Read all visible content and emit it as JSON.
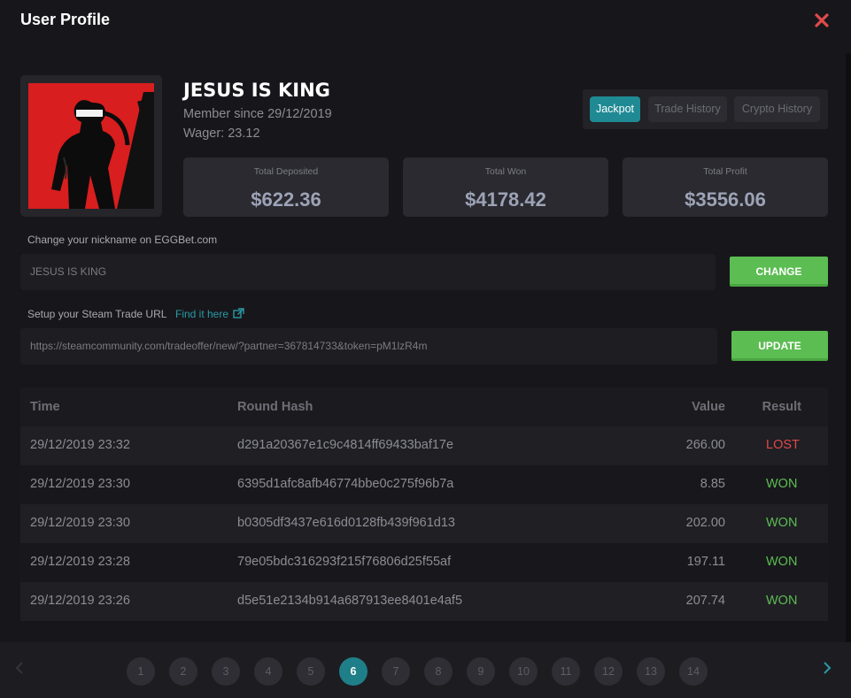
{
  "modal": {
    "title": "User Profile"
  },
  "profile": {
    "username": "JESUS IS KING",
    "member_since": "Member since 29/12/2019",
    "wager": "Wager: 23.12"
  },
  "tabs": [
    {
      "label": "Jackpot",
      "active": true
    },
    {
      "label": "Trade History",
      "active": false
    },
    {
      "label": "Crypto History",
      "active": false
    }
  ],
  "stats": [
    {
      "label": "Total Deposited",
      "value": "$622.36"
    },
    {
      "label": "Total Won",
      "value": "$4178.42"
    },
    {
      "label": "Total Profit",
      "value": "$3556.06"
    }
  ],
  "nickname": {
    "label": "Change your nickname on EGGBet.com",
    "value": "JESUS IS KING",
    "button": "CHANGE"
  },
  "trade_url": {
    "label": "Setup your Steam Trade URL",
    "link": "Find it here",
    "value": "https://steamcommunity.com/tradeoffer/new/?partner=367814733&token=pM1lzR4m",
    "button": "UPDATE"
  },
  "history": {
    "headers": [
      "Time",
      "Round Hash",
      "Value",
      "Result"
    ],
    "rows": [
      {
        "time": "29/12/2019 23:32",
        "hash": "d291a20367e1c9c4814ff69433baf17e",
        "value": "266.00",
        "result": "LOST"
      },
      {
        "time": "29/12/2019 23:30",
        "hash": "6395d1afc8afb46774bbe0c275f96b7a",
        "value": "8.85",
        "result": "WON"
      },
      {
        "time": "29/12/2019 23:30",
        "hash": "b0305df3437e616d0128fb439f961d13",
        "value": "202.00",
        "result": "WON"
      },
      {
        "time": "29/12/2019 23:28",
        "hash": "79e05bdc316293f215f76806d25f55af",
        "value": "197.11",
        "result": "WON"
      },
      {
        "time": "29/12/2019 23:26",
        "hash": "d5e51e2134b914a687913ee8401e4af5",
        "value": "207.74",
        "result": "WON"
      }
    ]
  },
  "pagination": {
    "pages": [
      "1",
      "2",
      "3",
      "4",
      "5",
      "6",
      "7",
      "8",
      "9",
      "10",
      "11",
      "12",
      "13",
      "14"
    ],
    "current": "6",
    "prev_icon": "chevron-left-icon",
    "next_icon": "chevron-right-icon"
  },
  "colors": {
    "accent": "#1f8a94",
    "button_green": "#5cbd52",
    "lost": "#e0484a",
    "won": "#5cbd52",
    "close": "#e04a4a"
  }
}
